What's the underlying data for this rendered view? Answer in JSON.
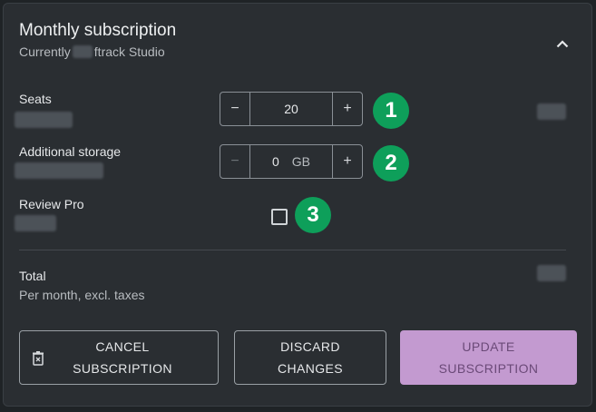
{
  "header": {
    "title": "Monthly subscription",
    "subtitle_prefix": "Currently",
    "subtitle_suffix": "ftrack Studio"
  },
  "seats": {
    "label": "Seats",
    "value": "20",
    "minus": "−",
    "plus": "+",
    "badge": "1"
  },
  "storage": {
    "label": "Additional storage",
    "value": "0",
    "unit": "GB",
    "minus": "−",
    "plus": "+",
    "badge": "2"
  },
  "review": {
    "label": "Review Pro",
    "checked": false,
    "badge": "3"
  },
  "total": {
    "label": "Total",
    "sublabel": "Per month, excl. taxes"
  },
  "actions": {
    "cancel_line1": "CANCEL",
    "cancel_line2": "SUBSCRIPTION",
    "discard_line1": "DISCARD",
    "discard_line2": "CHANGES",
    "update_line1": "UPDATE",
    "update_line2": "SUBSCRIPTION"
  },
  "icons": {
    "collapse": "chevron-up-icon",
    "cancel": "trash-icon"
  },
  "colors": {
    "badge": "#0e9f5a",
    "primary_button": "#c39ad0",
    "card_background": "#2a2e32"
  }
}
